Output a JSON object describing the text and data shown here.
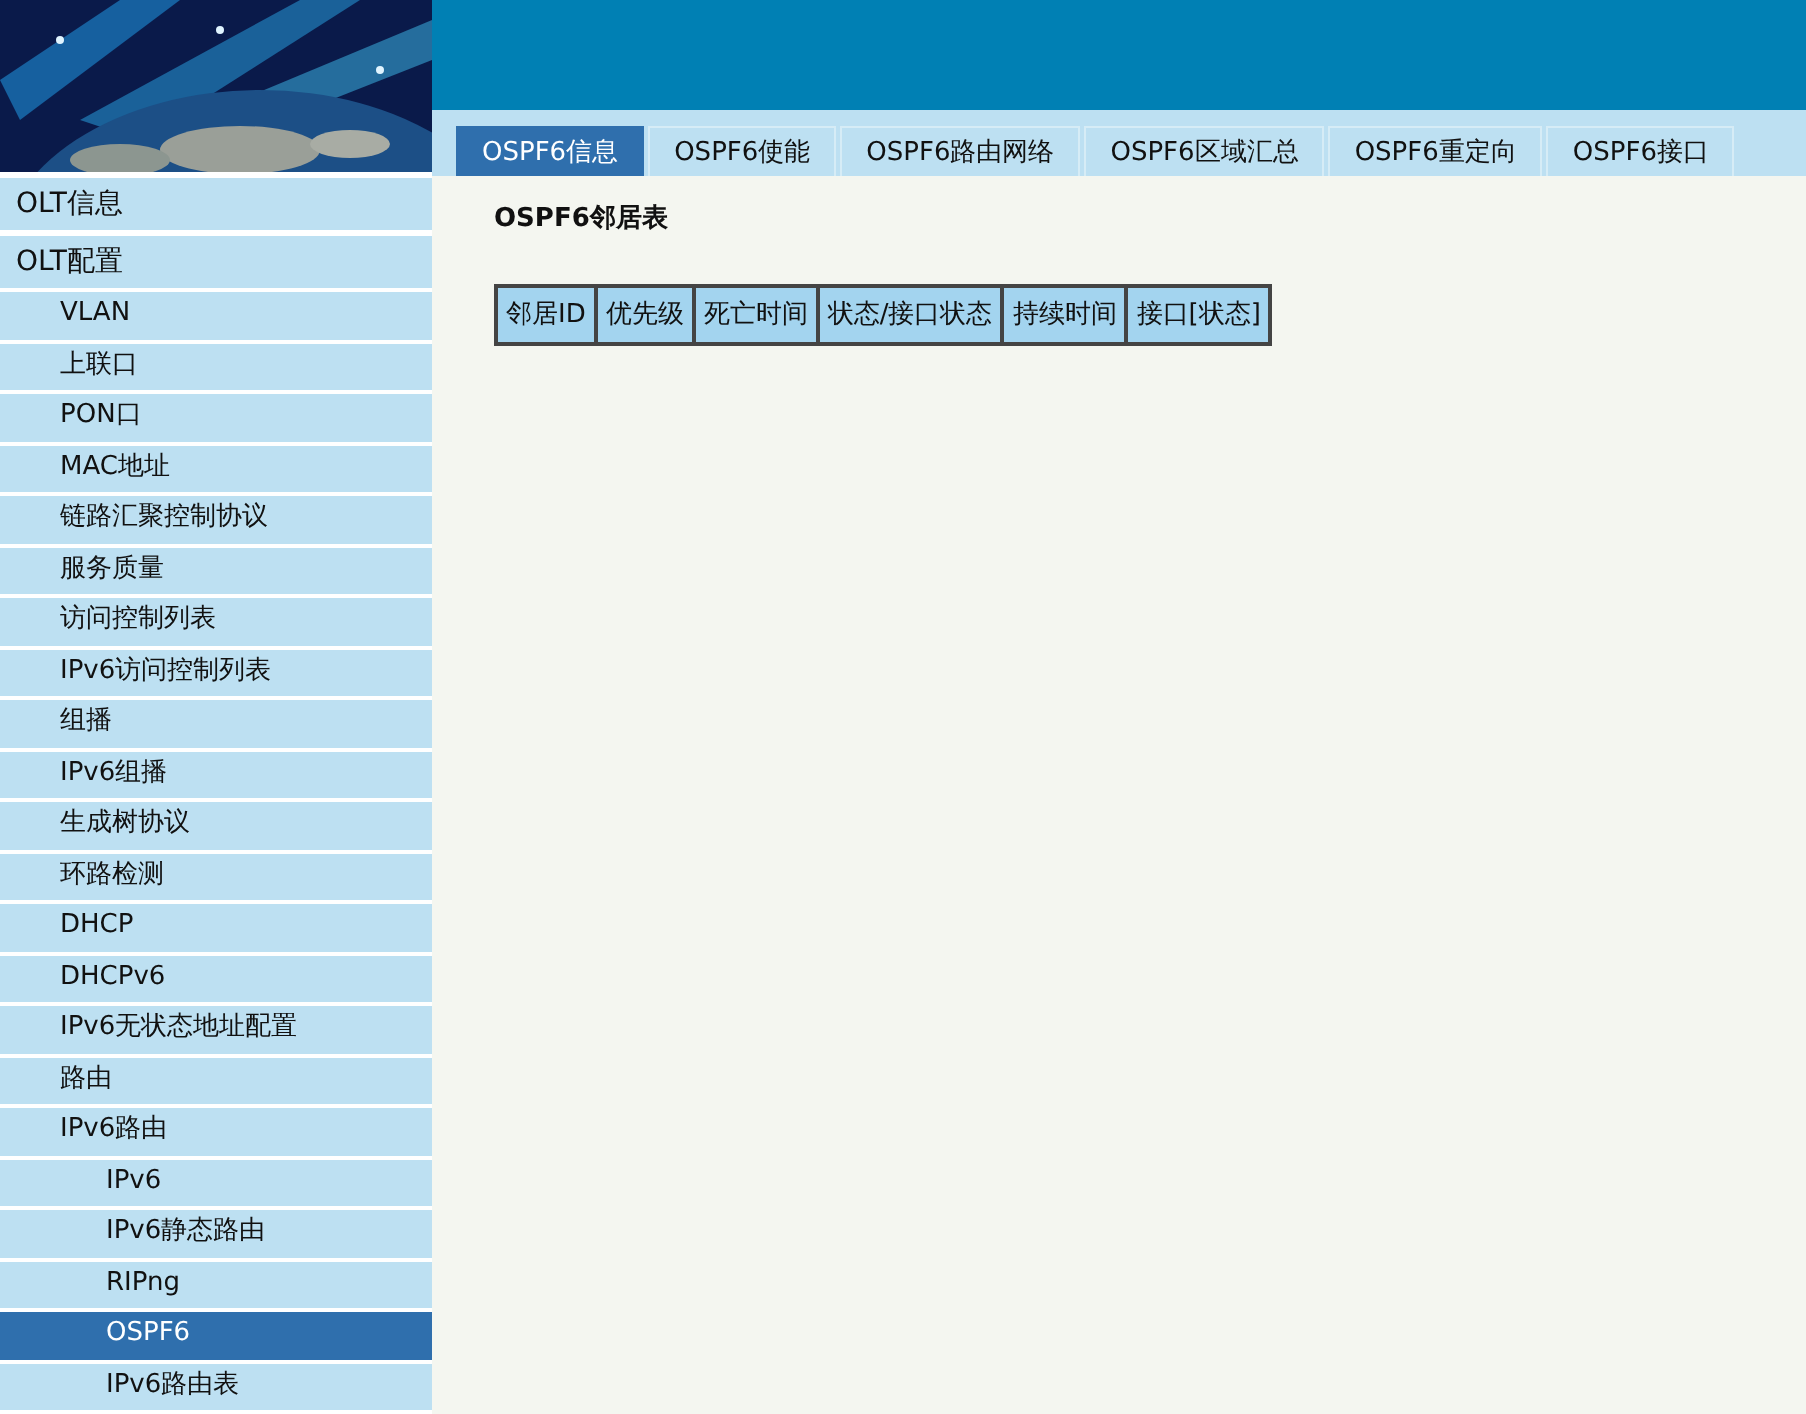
{
  "tabs": [
    {
      "label": "OSPF6信息",
      "selected": true
    },
    {
      "label": "OSPF6使能",
      "selected": false
    },
    {
      "label": "OSPF6路由网络",
      "selected": false
    },
    {
      "label": "OSPF6区域汇总",
      "selected": false
    },
    {
      "label": "OSPF6重定向",
      "selected": false
    },
    {
      "label": "OSPF6接口",
      "selected": false
    }
  ],
  "section_title": "OSPF6邻居表",
  "table": {
    "columns": [
      "邻居ID",
      "优先级",
      "死亡时间",
      "状态/接口状态",
      "持续时间",
      "接口[状态]"
    ]
  },
  "sidebar": {
    "items": [
      {
        "label": "OLT信息",
        "selected": false
      },
      {
        "label": "OLT配置",
        "selected": false,
        "children": [
          {
            "label": "VLAN",
            "selected": false
          },
          {
            "label": "上联口",
            "selected": false
          },
          {
            "label": "PON口",
            "selected": false
          },
          {
            "label": "MAC地址",
            "selected": false
          },
          {
            "label": "链路汇聚控制协议",
            "selected": false
          },
          {
            "label": "服务质量",
            "selected": false
          },
          {
            "label": "访问控制列表",
            "selected": false
          },
          {
            "label": "IPv6访问控制列表",
            "selected": false
          },
          {
            "label": "组播",
            "selected": false
          },
          {
            "label": "IPv6组播",
            "selected": false
          },
          {
            "label": "生成树协议",
            "selected": false
          },
          {
            "label": "环路检测",
            "selected": false
          },
          {
            "label": "DHCP",
            "selected": false
          },
          {
            "label": "DHCPv6",
            "selected": false
          },
          {
            "label": "IPv6无状态地址配置",
            "selected": false
          },
          {
            "label": "路由",
            "selected": false
          },
          {
            "label": "IPv6路由",
            "selected": false,
            "children": [
              {
                "label": "IPv6",
                "selected": false
              },
              {
                "label": "IPv6静态路由",
                "selected": false
              },
              {
                "label": "RIPng",
                "selected": false
              },
              {
                "label": "OSPF6",
                "selected": true
              },
              {
                "label": "IPv6路由表",
                "selected": false
              }
            ]
          }
        ]
      }
    ]
  }
}
